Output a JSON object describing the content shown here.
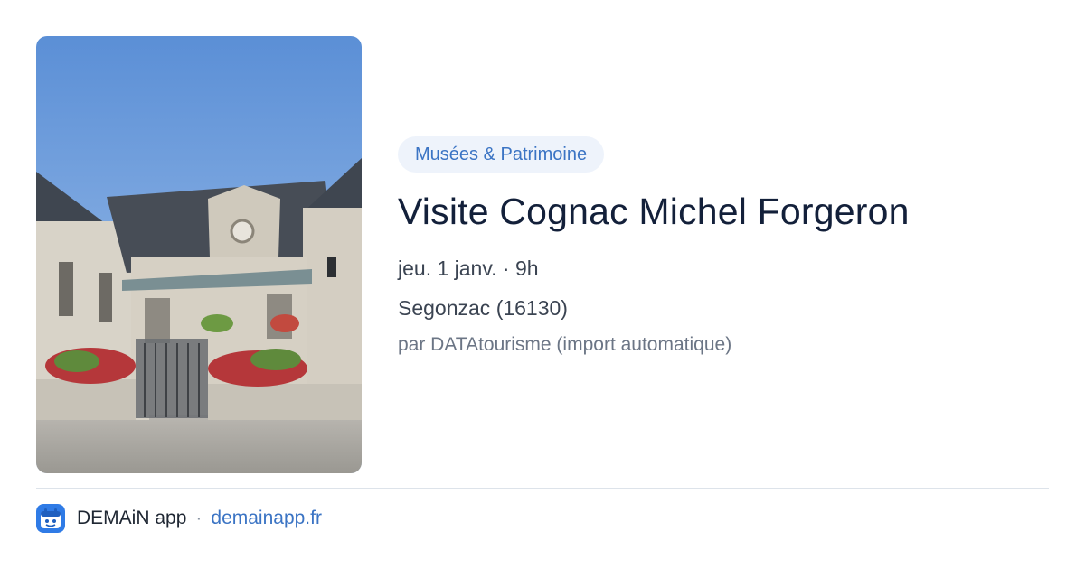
{
  "event": {
    "category": "Musées & Patrimoine",
    "title": "Visite Cognac Michel Forgeron",
    "date": "jeu. 1 janv. · 9h",
    "location": "Segonzac (16130)",
    "author": "par DATAtourisme (import automatique)",
    "image_icon": "building-photo"
  },
  "footer": {
    "app_name": "DEMAiN app",
    "separator": "·",
    "site": "demainapp.fr",
    "app_icon": "demain-app-icon"
  },
  "colors": {
    "accent": "#3b74c4",
    "chip_background": "#eef3fb",
    "title": "#13203a",
    "text": "#3b4452",
    "muted": "#6b7585"
  }
}
